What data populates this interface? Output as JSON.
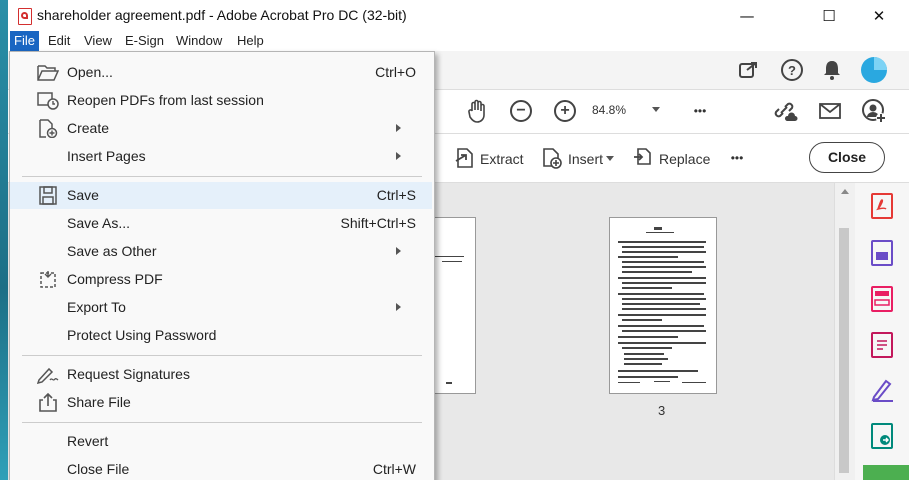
{
  "window": {
    "title": "shareholder agreement.pdf - Adobe Acrobat Pro DC (32-bit)"
  },
  "window_controls": {
    "minimize": "—",
    "maximize": "☐",
    "close": "✕"
  },
  "menubar": [
    "File",
    "Edit",
    "View",
    "E-Sign",
    "Window",
    "Help"
  ],
  "toolbar": {
    "zoom": "84.8%",
    "more": "•••",
    "tools": [
      "Extract",
      "Insert",
      "Replace"
    ],
    "close_label": "Close"
  },
  "document": {
    "page_number": "3"
  },
  "file_menu": [
    {
      "label": "Open...",
      "shortcut": "Ctrl+O",
      "icon": "folder-open-icon"
    },
    {
      "label": "Reopen PDFs from last session",
      "shortcut": "",
      "icon": "reopen-icon"
    },
    {
      "label": "Create",
      "shortcut": "",
      "icon": "create-pdf-icon",
      "submenu": true
    },
    {
      "label": "Insert Pages",
      "shortcut": "",
      "submenu": true
    },
    {
      "label": "Save",
      "shortcut": "Ctrl+S",
      "icon": "save-icon",
      "highlighted": true
    },
    {
      "label": "Save As...",
      "shortcut": "Shift+Ctrl+S"
    },
    {
      "label": "Save as Other",
      "shortcut": "",
      "submenu": true
    },
    {
      "label": "Compress PDF",
      "shortcut": "",
      "icon": "compress-icon"
    },
    {
      "label": "Export To",
      "shortcut": "",
      "submenu": true
    },
    {
      "label": "Protect Using Password",
      "shortcut": ""
    },
    {
      "label": "Request Signatures",
      "shortcut": "",
      "icon": "sign-pen-icon"
    },
    {
      "label": "Share File",
      "shortcut": "",
      "icon": "share-icon"
    },
    {
      "label": "Revert",
      "shortcut": ""
    },
    {
      "label": "Close File",
      "shortcut": "Ctrl+W"
    }
  ],
  "colors": {
    "accent": "#1a66c2",
    "menu_highlight": "#e5f0fa",
    "pdf_red": "#d32f2f"
  }
}
